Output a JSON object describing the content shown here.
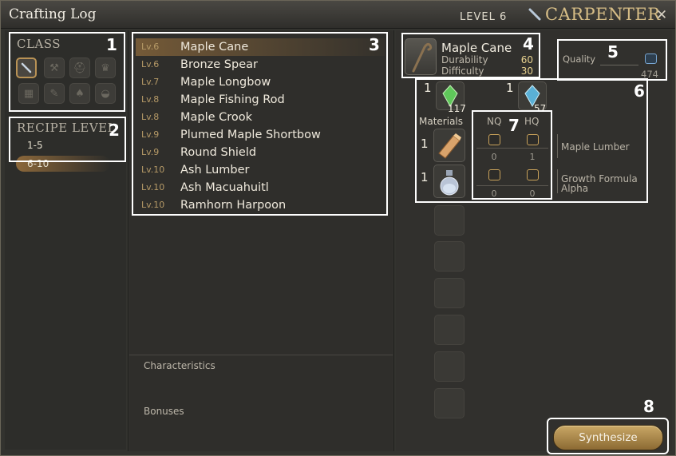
{
  "window": {
    "title": "Crafting Log",
    "level": "LEVEL 6",
    "job": "CARPENTER",
    "close_icon": "gear-close-icon"
  },
  "class_panel": {
    "label": "CLASS",
    "icons": [
      "carpenter-saw-icon",
      "blacksmith-anvil-icon",
      "armorer-helm-icon",
      "goldsmith-tiara-icon",
      "leatherworker-armor-icon",
      "weaver-needle-icon",
      "alchemist-flask-icon",
      "culinarian-dish-icon"
    ]
  },
  "recipe_level": {
    "label": "RECIPE LEVEL",
    "items": [
      "1-5",
      "6-10"
    ],
    "selected": "6-10"
  },
  "recipes": [
    {
      "lv": "Lv.6",
      "name": "Maple Cane"
    },
    {
      "lv": "Lv.6",
      "name": "Bronze Spear"
    },
    {
      "lv": "Lv.7",
      "name": "Maple Longbow"
    },
    {
      "lv": "Lv.8",
      "name": "Maple Fishing Rod"
    },
    {
      "lv": "Lv.8",
      "name": "Maple Crook"
    },
    {
      "lv": "Lv.9",
      "name": "Plumed Maple Shortbow"
    },
    {
      "lv": "Lv.9",
      "name": "Round Shield"
    },
    {
      "lv": "Lv.10",
      "name": "Ash Lumber"
    },
    {
      "lv": "Lv.10",
      "name": "Ash Macuahuitl"
    },
    {
      "lv": "Lv.10",
      "name": "Ramhorn Harpoon"
    }
  ],
  "middle_bottom": {
    "characteristics": "Characteristics",
    "bonuses": "Bonuses"
  },
  "item": {
    "name": "Maple Cane",
    "durability_label": "Durability",
    "durability": "60",
    "difficulty_label": "Difficulty",
    "difficulty": "30"
  },
  "quality": {
    "label": "Quality",
    "value": "474"
  },
  "crystals": [
    {
      "need": "1",
      "have": "117",
      "color": "#5fc75a"
    },
    {
      "need": "1",
      "have": "57",
      "color": "#5ab0d6"
    }
  ],
  "materials": {
    "label": "Materials",
    "nq": "NQ",
    "hq": "HQ",
    "items": [
      {
        "need": "1",
        "name": "Maple Lumber",
        "nq": "0",
        "hq": "1"
      },
      {
        "need": "1",
        "name": "Growth Formula Alpha",
        "nq": "0",
        "hq": "0"
      }
    ]
  },
  "annotations": [
    "1",
    "2",
    "3",
    "4",
    "5",
    "6",
    "7",
    "8"
  ],
  "synthesize_label": "Synthesize"
}
